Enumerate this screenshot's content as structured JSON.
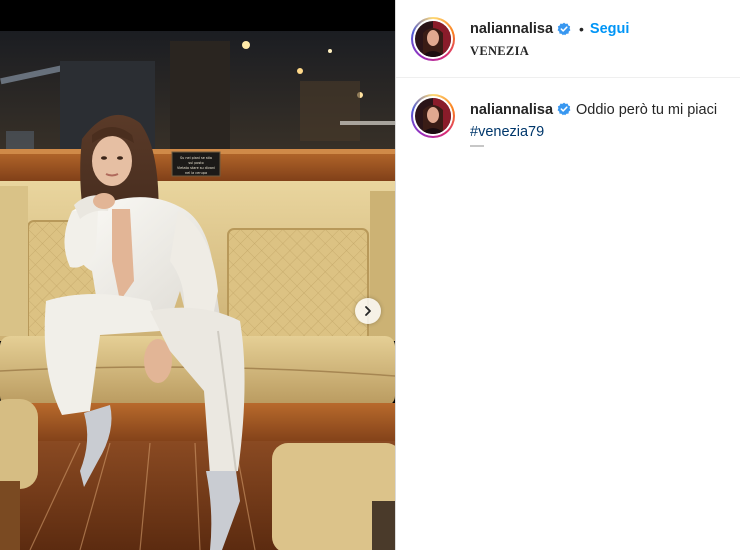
{
  "post": {
    "author": {
      "username": "naliannalisa",
      "verified": true,
      "location": "VENEZIA"
    },
    "follow_label": "Segui",
    "separator": "•",
    "caption": {
      "username": "naliannalisa",
      "text": "Oddio però tu mi piaci",
      "hashtag": "#venezia79"
    },
    "carousel": {
      "next_icon": "chevron-right-icon"
    },
    "photo": {
      "sign_text": [
        "Su nei piani se stia",
        "sul posto",
        "Vietato stare su divani",
        "nel la cerupa"
      ]
    }
  },
  "colors": {
    "accent": "#0095f6",
    "hashtag": "#00376b",
    "verified": "#3897f0",
    "text": "#262626"
  }
}
